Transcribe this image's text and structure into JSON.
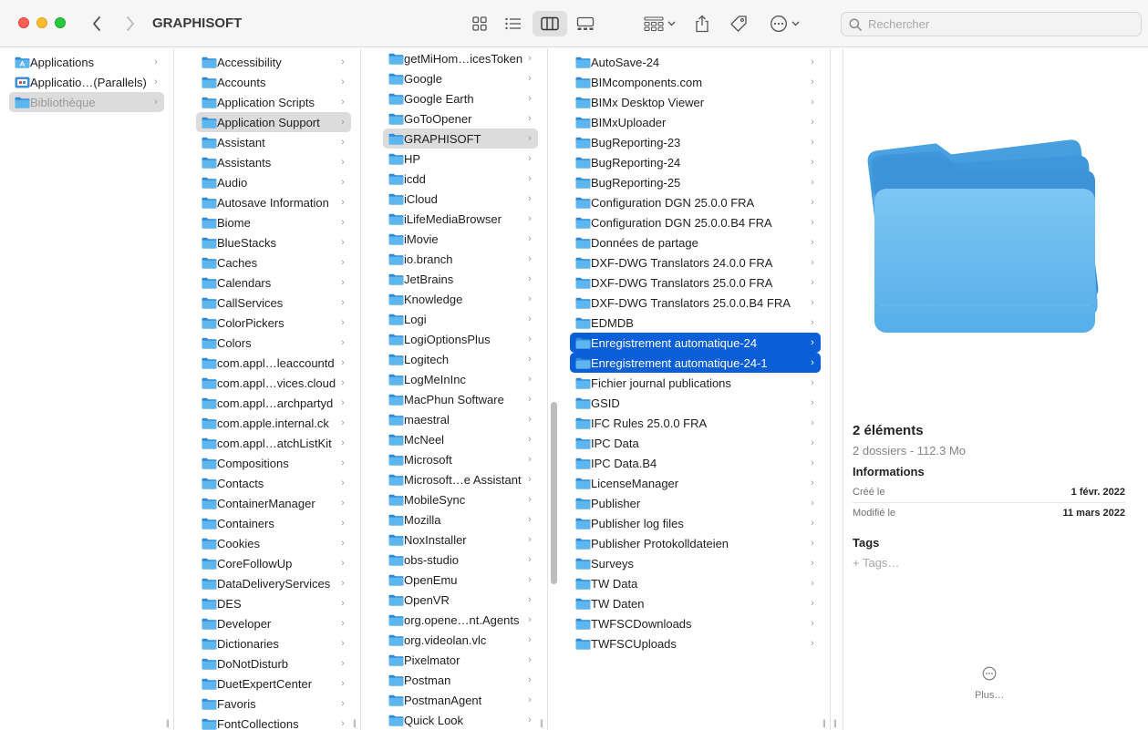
{
  "window": {
    "title": "GRAPHISOFT"
  },
  "search": {
    "placeholder": "Rechercher"
  },
  "sidebar": {
    "items": [
      {
        "label": "Applications",
        "icon": "applications-folder-icon"
      },
      {
        "label": "Applicatio…(Parallels)",
        "icon": "parallels-apps-icon"
      },
      {
        "label": "Bibliothèque",
        "icon": "folder-icon"
      }
    ]
  },
  "column2": [
    "Accessibility",
    "Accounts",
    "Application Scripts",
    "Application Support",
    "Assistant",
    "Assistants",
    "Audio",
    "Autosave Information",
    "Biome",
    "BlueStacks",
    "Caches",
    "Calendars",
    "CallServices",
    "ColorPickers",
    "Colors",
    "com.appl…leaccountd",
    "com.appl…vices.cloud",
    "com.appl…archpartyd",
    "com.apple.internal.ck",
    "com.appl…atchListKit",
    "Compositions",
    "Contacts",
    "ContainerManager",
    "Containers",
    "Cookies",
    "CoreFollowUp",
    "DataDeliveryServices",
    "DES",
    "Developer",
    "Dictionaries",
    "DoNotDisturb",
    "DuetExpertCenter",
    "Favoris",
    "FontCollections"
  ],
  "column3": [
    "getMiHom…icesToken",
    "Google",
    "Google Earth",
    "GoToOpener",
    "GRAPHISOFT",
    "HP",
    "icdd",
    "iCloud",
    "iLifeMediaBrowser",
    "iMovie",
    "io.branch",
    "JetBrains",
    "Knowledge",
    "Logi",
    "LogiOptionsPlus",
    "Logitech",
    "LogMeInInc",
    "MacPhun Software",
    "maestral",
    "McNeel",
    "Microsoft",
    "Microsoft…e Assistant",
    "MobileSync",
    "Mozilla",
    "NoxInstaller",
    "obs-studio",
    "OpenEmu",
    "OpenVR",
    "org.opene…nt.Agents",
    "org.videolan.vlc",
    "Pixelmator",
    "Postman",
    "PostmanAgent",
    "Quick Look"
  ],
  "column4": [
    "AutoSave-24",
    "BIMcomponents.com",
    "BIMx Desktop Viewer",
    "BIMxUploader",
    "BugReporting-23",
    "BugReporting-24",
    "BugReporting-25",
    "Configuration DGN 25.0.0 FRA",
    "Configuration DGN 25.0.0.B4 FRA",
    "Données de partage",
    "DXF-DWG Translators 24.0.0 FRA",
    "DXF-DWG Translators 25.0.0 FRA",
    "DXF-DWG Translators 25.0.0.B4 FRA",
    "EDMDB",
    "Enregistrement automatique-24",
    "Enregistrement automatique-24-1",
    "Fichier journal publications",
    "GSID",
    "IFC Rules 25.0.0 FRA",
    "IPC Data",
    "IPC Data.B4",
    "LicenseManager",
    "Publisher",
    "Publisher log files",
    "Publisher Protokolldateien",
    "Surveys",
    "TW Data",
    "TW Daten",
    "TWFSCDownloads",
    "TWFSCUploads"
  ],
  "preview": {
    "title": "2 éléments",
    "subtitle": "2 dossiers - 112.3 Mo",
    "info_heading": "Informations",
    "created_label": "Créé le",
    "created_value": "1 févr. 2022",
    "modified_label": "Modifié le",
    "modified_value": "11 mars 2022",
    "tags_heading": "Tags",
    "tags_placeholder": "+ Tags…",
    "more_label": "Plus…"
  },
  "colors": {
    "selection_active": "#0a5fd9",
    "selection_inactive": "#dcdcdc",
    "folder_blue": "#5eb6ef"
  }
}
